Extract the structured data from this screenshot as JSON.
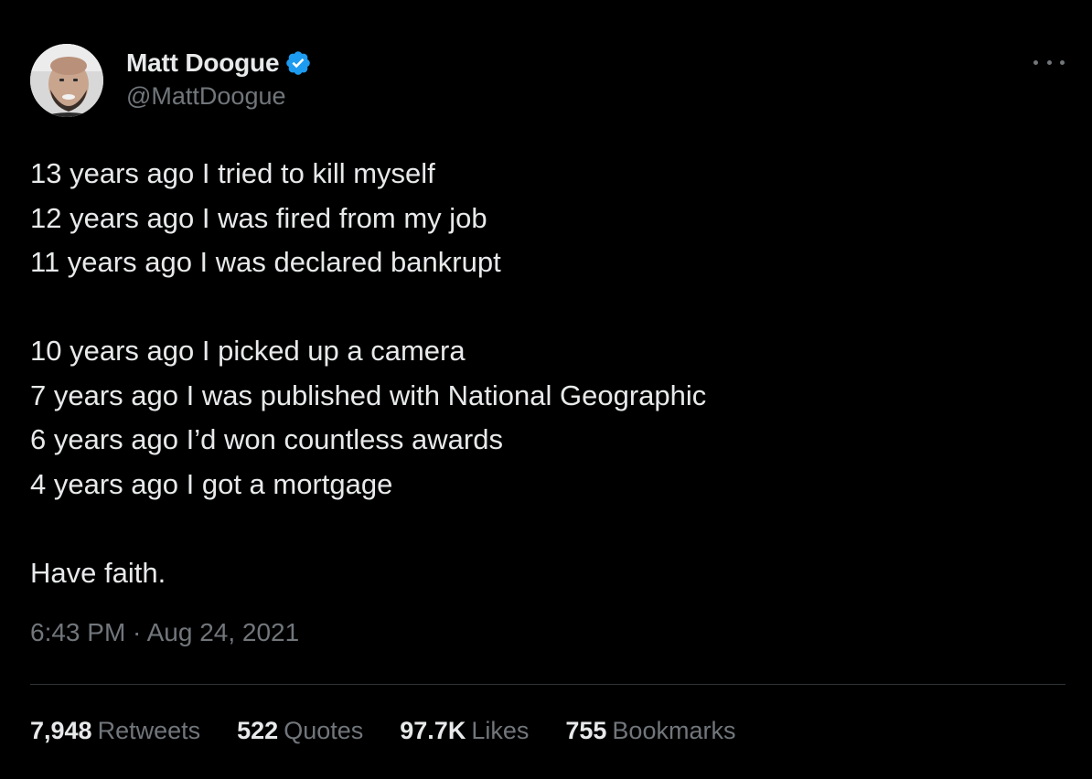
{
  "author": {
    "display_name": "Matt Doogue",
    "handle": "@MattDoogue",
    "verified": true,
    "verified_icon": "verified-badge-icon",
    "verified_color": "#1d9bf0"
  },
  "menu": {
    "icon": "more-options-icon"
  },
  "tweet": {
    "lines": [
      "13 years ago I tried to kill myself",
      "12 years ago I was fired from my job",
      "11 years ago I was declared bankrupt",
      "",
      "10 years ago I picked up a camera",
      "7 years ago I was published with National Geographic",
      "6 years ago I’d won countless awards",
      "4 years ago I got a mortgage",
      "",
      "Have faith."
    ],
    "timestamp": "6:43 PM · Aug 24, 2021"
  },
  "stats": [
    {
      "count": "7,948",
      "label": "Retweets"
    },
    {
      "count": "522",
      "label": "Quotes"
    },
    {
      "count": "97.7K",
      "label": "Likes"
    },
    {
      "count": "755",
      "label": "Bookmarks"
    }
  ],
  "colors": {
    "background": "#000000",
    "text_primary": "#e7e9ea",
    "text_secondary": "#71767b",
    "divider": "#2f3336"
  }
}
